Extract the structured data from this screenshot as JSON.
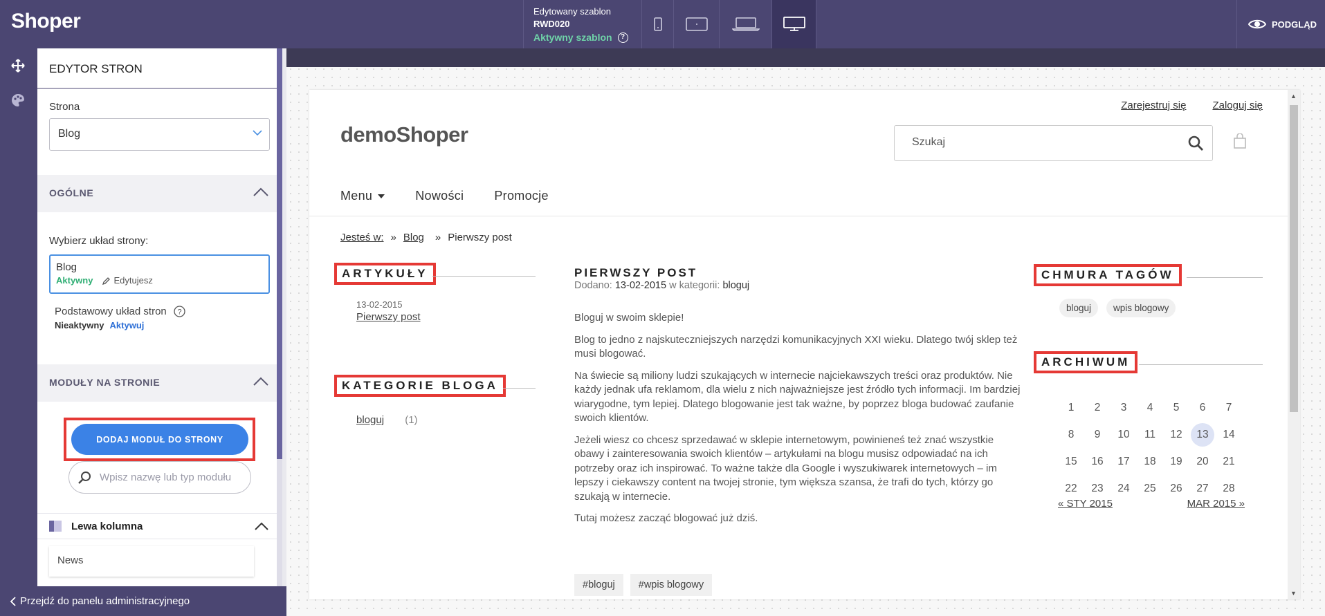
{
  "app": {
    "logo": "Shoper",
    "template": {
      "label": "Edytowany szablon",
      "name": "RWD020",
      "status": "Aktywny szablon",
      "help": "?"
    },
    "devices": [
      "mobile-icon",
      "tablet-icon",
      "laptop-icon",
      "desktop-icon"
    ],
    "active_device": "desktop-icon",
    "preview_label": "PODGLĄD",
    "back_link": "Przejdź do panelu administracyjnego"
  },
  "panel": {
    "title": "EDYTOR STRON",
    "page_label": "Strona",
    "page_value": "Blog",
    "general_section": "OGÓLNE",
    "layout_label": "Wybierz układ strony:",
    "current_layout": {
      "name": "Blog",
      "status": "Aktywny",
      "edit": "Edytujesz"
    },
    "basic_layout": {
      "name": "Podstawowy układ stron",
      "status": "Nieaktywny",
      "action": "Aktywuj"
    },
    "modules_section": "MODUŁY NA STRONIE",
    "add_module_button": "DODAJ MODUŁ DO STRONY",
    "module_search_placeholder": "Wpisz nazwę lub typ modułu",
    "left_column": "Lewa kolumna",
    "left_column_items": [
      "News"
    ]
  },
  "site": {
    "top_links": [
      "Zarejestruj się",
      "Zaloguj się"
    ],
    "logo": "demoShoper",
    "search_placeholder": "Szukaj",
    "nav": [
      "Menu",
      "Nowości",
      "Promocje"
    ],
    "breadcrumb": {
      "prefix": "Jesteś w:",
      "sep": "»",
      "items": [
        "Blog",
        "Pierwszy post"
      ]
    },
    "articles": {
      "heading": "ARTYKUŁY",
      "items": [
        {
          "date": "13-02-2015",
          "title": "Pierwszy post"
        }
      ]
    },
    "categories": {
      "heading": "KATEGORIE BLOGA",
      "items": [
        {
          "name": "bloguj",
          "count": "(1)"
        }
      ]
    },
    "post": {
      "title": "PIERWSZY POST",
      "meta_added": "Dodano:",
      "meta_date": "13-02-2015",
      "meta_in": "w kategorii:",
      "meta_category": "bloguj",
      "paragraphs": [
        "Bloguj w swoim sklepie!",
        "Blog to jedno z najskuteczniejszych narzędzi komunikacyjnych XXI wieku. Dlatego twój sklep też musi blogować.",
        "Na świecie są miliony ludzi szukających w internecie najciekawszych treści oraz produktów. Nie każdy jednak ufa reklamom, dla wielu z nich najważniejsze jest źródło tych informacji. Im bardziej wiarygodne, tym lepiej. Dlatego blogowanie jest tak ważne, by poprzez bloga budować zaufanie swoich klientów.",
        "Jeżeli wiesz co chcesz sprzedawać w sklepie internetowym, powinieneś też znać wszystkie obawy i zainteresowania swoich klientów – artykułami na blogu musisz odpowiadać na ich potrzeby oraz ich inspirować. To ważne także dla Google i wyszukiwarek internetowych – im lepszy i ciekawszy content na twojej stronie, tym większa szansa, że trafi do tych, którzy go szukają w internecie.",
        "Tutaj możesz zacząć blogować już dziś."
      ],
      "tags": [
        "#bloguj",
        "#wpis blogowy"
      ]
    },
    "tag_cloud": {
      "heading": "CHMURA TAGÓW",
      "tags": [
        "bloguj",
        "wpis blogowy"
      ]
    },
    "archive": {
      "heading": "ARCHIWUM",
      "weeks": [
        [
          "1",
          "2",
          "3",
          "4",
          "5",
          "6",
          "7"
        ],
        [
          "8",
          "9",
          "10",
          "11",
          "12",
          "13",
          "14"
        ],
        [
          "15",
          "16",
          "17",
          "18",
          "19",
          "20",
          "21"
        ],
        [
          "22",
          "23",
          "24",
          "25",
          "26",
          "27",
          "28"
        ]
      ],
      "highlighted_day": "13",
      "prev": "« STY 2015",
      "next": "MAR 2015 »"
    }
  },
  "colors": {
    "topbar": "#4b4672",
    "accent_blue": "#3b82e6",
    "active_green": "#2fae74",
    "highlight_red": "#e53935"
  }
}
